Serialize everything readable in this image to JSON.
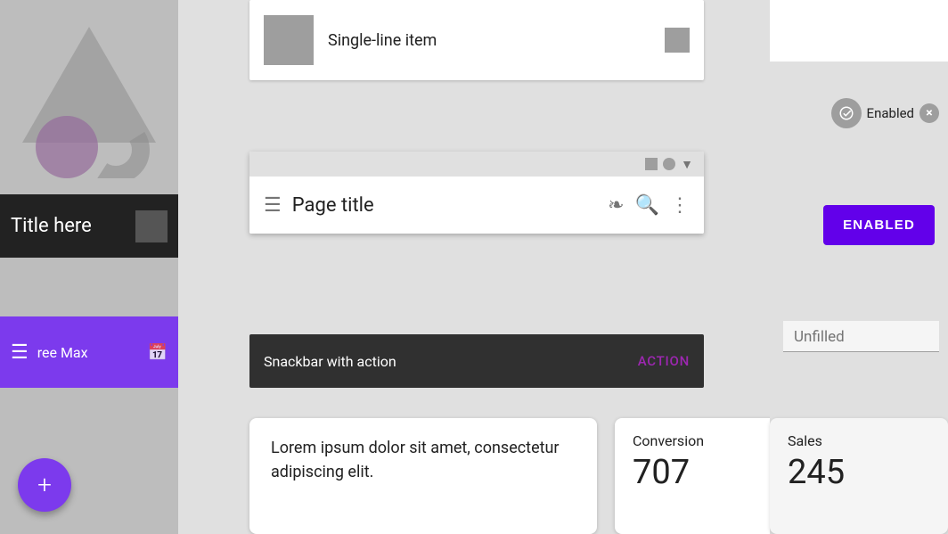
{
  "sidebar": {
    "title": "Title here",
    "purple_item_label": "ree Max"
  },
  "fab": {
    "label": "+"
  },
  "single_line": {
    "text": "Single-line item"
  },
  "app_bar": {
    "title": "Page title"
  },
  "snackbar": {
    "message": "Snackbar with action",
    "action": "ACTION"
  },
  "bottom_card_text": {
    "content": "Lorem ipsum dolor sit amet, consectetur adipiscing elit."
  },
  "bottom_card_conversion": {
    "label": "Conversion",
    "value": "707"
  },
  "bottom_card_sales": {
    "label": "Sales",
    "value": "245"
  },
  "right_panel": {
    "chip_label": "Enabled",
    "enabled_button": "ENABLED",
    "unfilled_placeholder": "Unfilled"
  }
}
